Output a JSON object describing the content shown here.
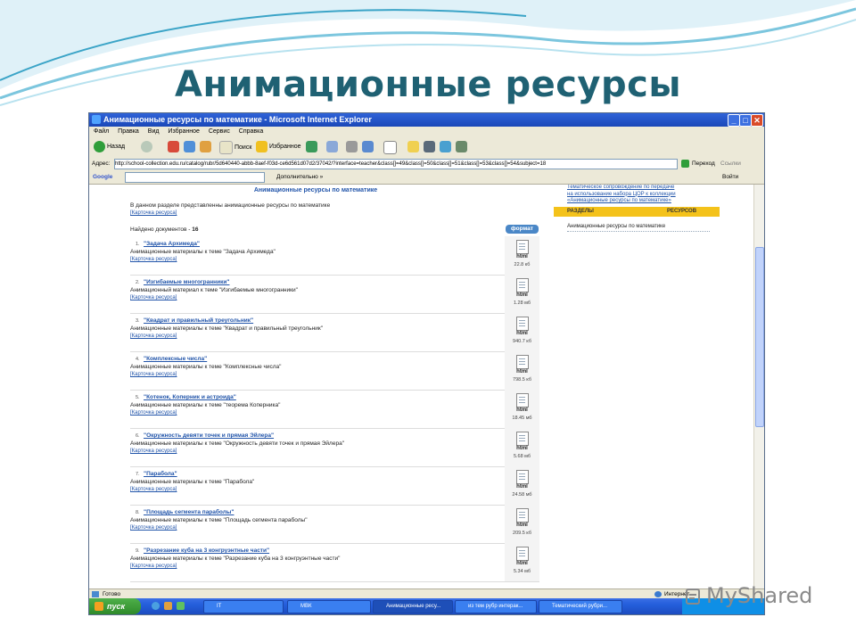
{
  "slide_title": "Анимационные ресурсы",
  "window": {
    "title": "Анимационные ресурсы по математике - Microsoft Internet Explorer",
    "menu": [
      "Файл",
      "Правка",
      "Вид",
      "Избранное",
      "Сервис",
      "Справка"
    ],
    "toolbar": {
      "back": "Назад",
      "search": "Поиск",
      "favorites": "Избранное"
    },
    "address_label": "Адрес:",
    "address_url": "http://school-collection.edu.ru/catalog/rubr/5d640440-abbb-8aef-f03d-ce6d561d07d2/37042/?interface=teacher&class[]=49&class[]=50&class[]=51&class[]=53&class[]=54&subject=18",
    "go_label": "Переход",
    "links_label": "Ссылки",
    "google_label": "Google",
    "google_extra": "Дополнительно »",
    "google_signin": "Войти",
    "status": "Готово",
    "status_zone": "Интернет"
  },
  "page": {
    "header": "Анимационные ресурсы по математике",
    "intro": "В данном разделе представленны анимационные ресурсы по математике",
    "intro_link": "[Карточка ресурса]",
    "found_label": "Найдено документов - ",
    "found_count": "16",
    "format_label": "формат",
    "items": [
      {
        "num": "1.",
        "title": "\"Задача Архимеда\"",
        "desc": "Анимационные материалы к теме \"Задача Архимеда\"",
        "card": "[Карточка ресурса]",
        "ftype": "html",
        "size": "22.8 кб"
      },
      {
        "num": "2.",
        "title": "\"Изгибаемые многогранники\"",
        "desc": "Анимационный материал к теме \"Изгибаемые многогранники\"",
        "card": "[Карточка ресурса]",
        "ftype": "html",
        "size": "1.28 мб"
      },
      {
        "num": "3.",
        "title": "\"Квадрат и правильный треугольник\"",
        "desc": "Анимационные материалы к теме \"Квадрат и правильный треугольник\"",
        "card": "[Карточка ресурса]",
        "ftype": "html",
        "size": "940.7 кб"
      },
      {
        "num": "4.",
        "title": "\"Комплексные числа\"",
        "desc": "Анимационные материалы к теме \"Комплексные числа\"",
        "card": "[Карточка ресурса]",
        "ftype": "html",
        "size": "798.5 кб"
      },
      {
        "num": "5.",
        "title": "\"Котенок, Коперник и астроида\"",
        "desc": "Анимационные материалы к теме \"теорема Коперника\"",
        "card": "[Карточка ресурса]",
        "ftype": "html",
        "size": "18.45 мб"
      },
      {
        "num": "6.",
        "title": "\"Окружность девяти точек и прямая Эйлера\"",
        "desc": "Анимационные материалы к теме \"Окружность девяти точек и прямая Эйлера\"",
        "card": "[Карточка ресурса]",
        "ftype": "html",
        "size": "5.68 мб"
      },
      {
        "num": "7.",
        "title": "\"Парабола\"",
        "desc": "Анимационные материалы к теме \"Парабола\"",
        "card": "[Карточка ресурса]",
        "ftype": "html",
        "size": "24.58 мб"
      },
      {
        "num": "8.",
        "title": "\"Площадь сегмента параболы\"",
        "desc": "Анимационные материалы к теме \"Площадь сегмента параболы\"",
        "card": "[Карточка ресурса]",
        "ftype": "html",
        "size": "209.5 кб"
      },
      {
        "num": "9.",
        "title": "\"Разрезание куба на 3 конгруэнтные части\"",
        "desc": "Анимационные материалы к теме \"Разрезание куба на 3 конгруэнтные части\"",
        "card": "[Карточка ресурса]",
        "ftype": "html",
        "size": "5.34 мб"
      }
    ],
    "side_links": [
      "Тематическое сопровождение по передаче",
      "на использование набора ЦОР к коллекции",
      "«Анимационные ресурсы по математике»"
    ],
    "side_head_left": "РАЗДЕЛЫ",
    "side_head_right": "РЕСУРСОВ",
    "side_item": "Анимационные ресурсы по математике"
  },
  "taskbar": {
    "start": "пуск",
    "tasks": [
      "IT",
      "МВК",
      "Анимационные ресу...",
      "из тем рубр интерак...",
      "Тематический рубри..."
    ]
  },
  "brand": "MyShared",
  "colors": {
    "title": "#1f6173",
    "link": "#2255aa",
    "format_badge": "#4a87c7",
    "side_header": "#f4c21a"
  }
}
